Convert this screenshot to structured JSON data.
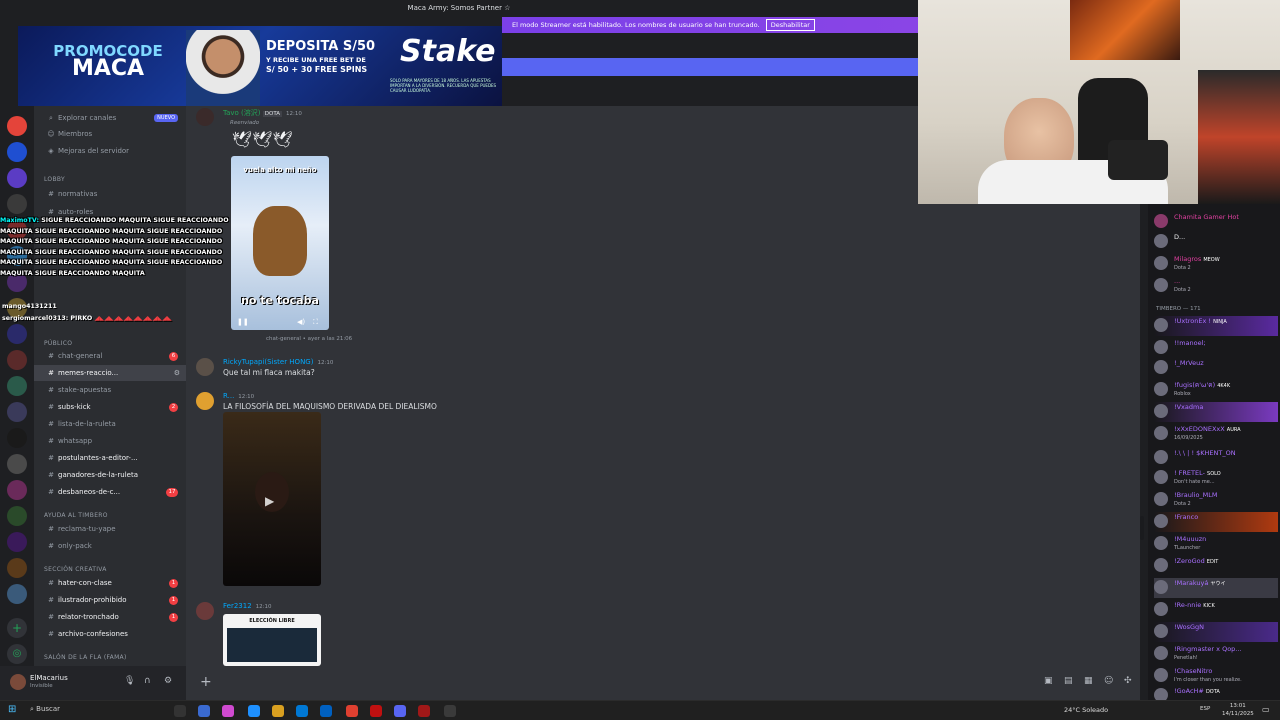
{
  "titlebar": {
    "title": "Maca Army: Somos Partner ☆"
  },
  "streamer_bar": {
    "text": "El modo Streamer está habilitado. Los nombres de usuario se han truncado.",
    "button": "Deshabilitar"
  },
  "banner": {
    "promo_top": "PROMOCODE",
    "promo_code": "MACA",
    "deposit_title": "DEPOSITA S/50",
    "deposit_sub": "Y RECIBE UNA FREE BET DE",
    "deposit_sub2": "S/ 50 + 30 FREE SPINS",
    "brand": "Stake",
    "legal": "SOLO PARA MAYORES DE 18 AÑOS. LAS APUESTAS IMPORTAN A LA DIVERSIÓN. RECUERDA QUE PUEDES CAUSAR LUDOPATÍA."
  },
  "sidebar": {
    "top_items": [
      {
        "label": "Explorar canales",
        "badge": "NUEVO"
      },
      {
        "label": "Miembros"
      },
      {
        "label": "Mejoras del servidor"
      }
    ],
    "categories": [
      {
        "label": "LOBBY"
      },
      {
        "label": "PÚBLICO"
      },
      {
        "label": "AYUDA AL TIMBERO"
      },
      {
        "label": "SECCIÓN CREATIVA"
      },
      {
        "label": "SALÓN DE LA FLA (FAMA)"
      }
    ],
    "channels": [
      {
        "label": "normativas"
      },
      {
        "label": "auto-roles"
      },
      {
        "label": "chat-general",
        "badge": "6"
      },
      {
        "label": "memes-reaccio..."
      },
      {
        "label": "stake-apuestas"
      },
      {
        "label": "subs-kick",
        "badge": "2"
      },
      {
        "label": "lista-de-la-ruleta"
      },
      {
        "label": "whatsapp"
      },
      {
        "label": "postulantes-a-editor-..."
      },
      {
        "label": "ganadores-de-la-ruleta"
      },
      {
        "label": "desbaneos-de-c...",
        "badge": "17"
      },
      {
        "label": "reclama-tu-yape"
      },
      {
        "label": "only-pack"
      },
      {
        "label": "hater-con-clase",
        "badge": "1"
      },
      {
        "label": "ilustrador-prohibido",
        "badge": "1"
      },
      {
        "label": "relator-tronchado",
        "badge": "1"
      },
      {
        "label": "archivo-confesiones"
      }
    ]
  },
  "user_panel": {
    "name": "ElMacarius",
    "status": "Invisible"
  },
  "overlay": {
    "spam": "SIGUE REACCIOANDO MAQUITA SIGUE REACCIOANDO MAQUITA SIGUE REACCIOANDO MAQUITA SIGUE REACCIOANDO MAQUITA SIGUE REACCIOANDO MAQUITA SIGUE REACCIOANDO MAQUITA SIGUE REACCIOANDO MAQUITA SIGUE REACCIOANDO MAQUITA SIGUE REACCIOANDO MAQUITA SIGUE REACCIOANDO MAQUITA SIGUE REACCIOANDO MAQUITA",
    "spam_author": "MaximoTV:",
    "line2_author": "mango4131211",
    "line3": "sergiomarcel0313: PIRKO"
  },
  "chat": {
    "messages": [
      {
        "author": "Tavo (溶沢)",
        "tag": "DOTA",
        "time": "12:10",
        "forwarded": "Reenviado",
        "caption_top": "vuela alto mi neño",
        "caption_bottom": "no te tocaba",
        "ref": "chat-general • ayer a las 21:06"
      },
      {
        "author": "RickyTupapi(Sister HONG)",
        "time": "12:10",
        "text": "Que tal mi flaca makita?"
      },
      {
        "author": "R...",
        "time": "12:10",
        "text": "LA FILOSOFÍA DEL MAQUISMO DERIVADA DEL DIEALISMO"
      },
      {
        "author": "Fer2312",
        "time": "12:10",
        "preview": "ELECCIÓN LIBRE"
      }
    ]
  },
  "twitch_chat": {
    "top_user": "Chamita Gamer Hot",
    "section": "TIMBERO — 171",
    "users": [
      {
        "name": "D...",
        "sub": ""
      },
      {
        "name": "Milagros",
        "sub": "Dota 2",
        "badge": "MEOW"
      },
      {
        "name": "...",
        "sub": "Dota 2"
      },
      {
        "name": "!UxtronEx !",
        "badge": "NINJA"
      },
      {
        "name": "!!manoel;",
        "sub": ""
      },
      {
        "name": "!_MrVeuz",
        "sub": ""
      },
      {
        "name": "!fugis(ฅ'ω'ฅ)",
        "badge": "4K4K",
        "sub": "Roblox"
      },
      {
        "name": "!Vxadma",
        "sub": ""
      },
      {
        "name": "!xXxEDONEXxX",
        "badge": "AURA",
        "sub": "16/09/2025"
      },
      {
        "name": "!.\\ \\ | ! $KHENT_ON",
        "sub": ""
      },
      {
        "name": "! FRETEL-",
        "badge": "SOLO",
        "sub": "Don't hate me..."
      },
      {
        "name": "!Braulio_MLM",
        "sub": "Dota 2"
      },
      {
        "name": "!Franco",
        "sub": ""
      },
      {
        "name": "!M4uuuzn",
        "sub": "TLauncher"
      },
      {
        "name": "!ZeroGod",
        "badge": "EDIT"
      },
      {
        "name": "!Marakuyá",
        "badge": "ヤウイ"
      },
      {
        "name": "!Re-nnie",
        "badge": "KICK"
      },
      {
        "name": "!WosGgN",
        "sub": ""
      },
      {
        "name": "!Ringmaster x Qop...",
        "sub": "Penetlah!"
      },
      {
        "name": "!ChaseNitro",
        "sub": "I'm closer than you realize."
      },
      {
        "name": "!GoAcH#",
        "badge": "DOTA"
      }
    ]
  },
  "taskbar": {
    "search": "Buscar",
    "weather": "24°C Soleado",
    "time": "13:01",
    "date": "14/11/2025",
    "lang": "ESP"
  },
  "colors": {
    "accent": "#5865f2",
    "streamer": "#7b40e8",
    "twitch_purple": "#a970ff",
    "notif": "#f23f43"
  }
}
